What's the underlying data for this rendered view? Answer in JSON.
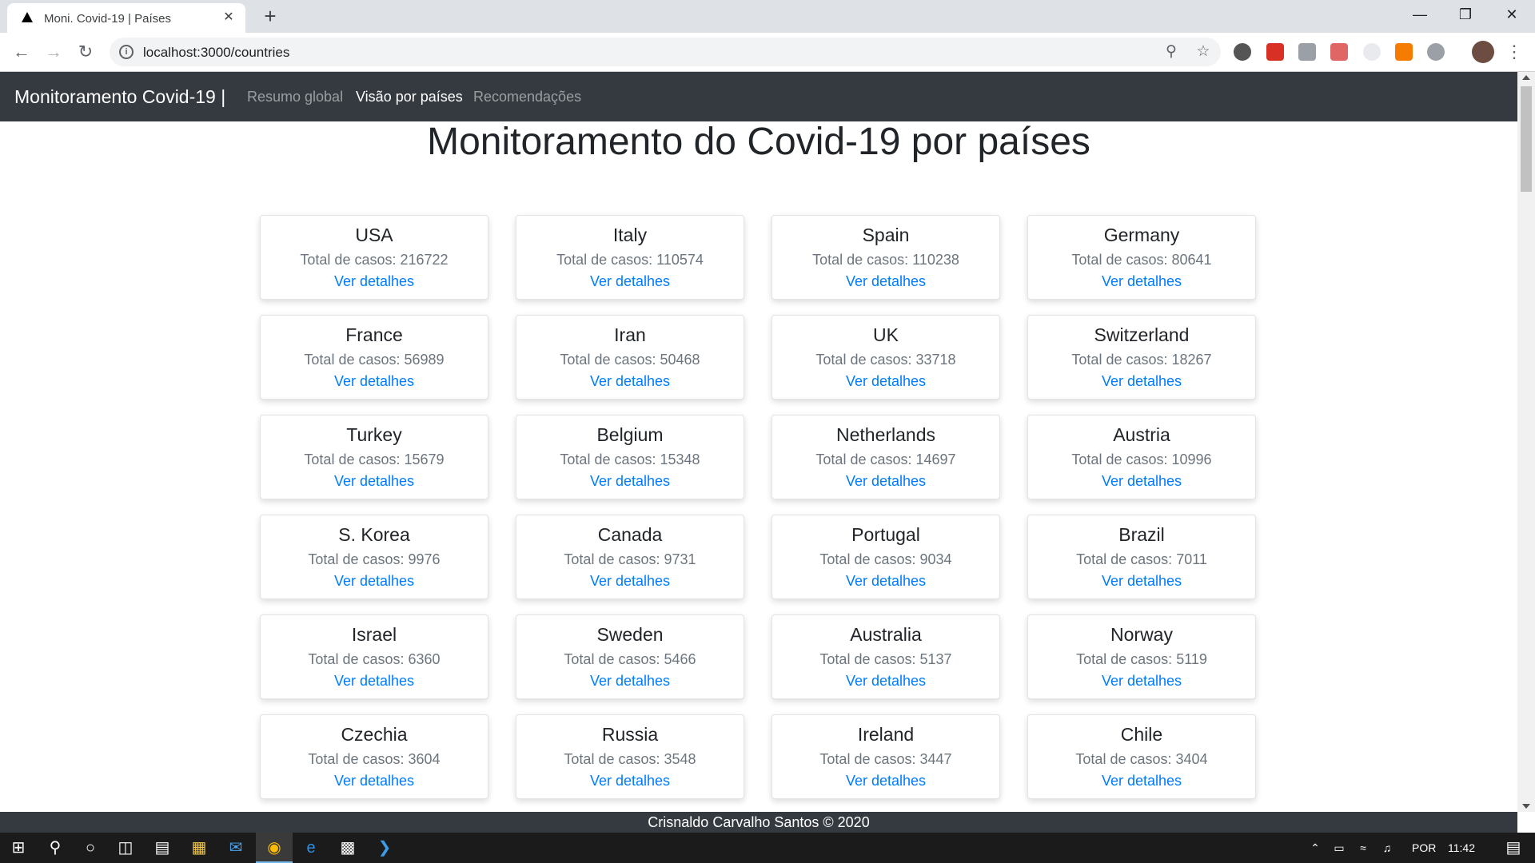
{
  "browser": {
    "tab_title": "Moni. Covid-19 | Países",
    "tab_close": "✕",
    "new_tab": "+",
    "url": "localhost:3000/countries",
    "window_controls": {
      "minimize": "—",
      "restore": "❐",
      "close": "✕"
    },
    "icons": {
      "back": "arrow-left-icon",
      "forward": "arrow-right-icon",
      "reload": "reload-icon",
      "zoom": "zoom-icon",
      "bookmark": "star-icon",
      "menu": "kebab-menu-icon"
    }
  },
  "navbar": {
    "brand": "Monitoramento Covid-19 |",
    "links": [
      {
        "label": "Resumo global",
        "active": false
      },
      {
        "label": "Visão por países",
        "active": true
      },
      {
        "label": "Recomendações",
        "active": false
      }
    ]
  },
  "page": {
    "title": "Monitoramento do Covid-19 por países",
    "total_label": "Total de casos:",
    "link_label": "Ver detalhes"
  },
  "countries": [
    {
      "name": "USA",
      "total": 216722
    },
    {
      "name": "Italy",
      "total": 110574
    },
    {
      "name": "Spain",
      "total": 110238
    },
    {
      "name": "Germany",
      "total": 80641
    },
    {
      "name": "France",
      "total": 56989
    },
    {
      "name": "Iran",
      "total": 50468
    },
    {
      "name": "UK",
      "total": 33718
    },
    {
      "name": "Switzerland",
      "total": 18267
    },
    {
      "name": "Turkey",
      "total": 15679
    },
    {
      "name": "Belgium",
      "total": 15348
    },
    {
      "name": "Netherlands",
      "total": 14697
    },
    {
      "name": "Austria",
      "total": 10996
    },
    {
      "name": "S. Korea",
      "total": 9976
    },
    {
      "name": "Canada",
      "total": 9731
    },
    {
      "name": "Portugal",
      "total": 9034
    },
    {
      "name": "Brazil",
      "total": 7011
    },
    {
      "name": "Israel",
      "total": 6360
    },
    {
      "name": "Sweden",
      "total": 5466
    },
    {
      "name": "Australia",
      "total": 5137
    },
    {
      "name": "Norway",
      "total": 5119
    },
    {
      "name": "Czechia",
      "total": 3604
    },
    {
      "name": "Russia",
      "total": 3548
    },
    {
      "name": "Ireland",
      "total": 3447
    },
    {
      "name": "Chile",
      "total": 3404
    }
  ],
  "footer": "Crisnaldo Carvalho Santos © 2020",
  "taskbar": {
    "language": "POR",
    "time": "11:42"
  },
  "colors": {
    "navbar_bg": "#343a40",
    "link": "#007bff",
    "muted_text": "#6c757d",
    "heading_text": "#212529"
  }
}
